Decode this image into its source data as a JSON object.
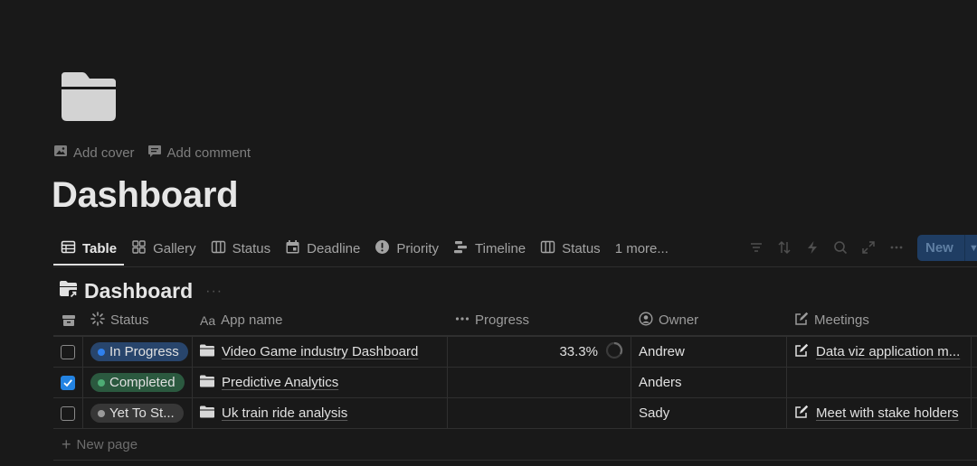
{
  "page": {
    "icon": "folder-icon",
    "add_cover": "Add cover",
    "add_comment": "Add comment",
    "title": "Dashboard"
  },
  "tabs": [
    {
      "label": "Table",
      "icon": "table-icon",
      "active": true
    },
    {
      "label": "Gallery",
      "icon": "gallery-icon"
    },
    {
      "label": "Status",
      "icon": "board-icon"
    },
    {
      "label": "Deadline",
      "icon": "calendar-icon"
    },
    {
      "label": "Priority",
      "icon": "alert-icon"
    },
    {
      "label": "Timeline",
      "icon": "timeline-icon"
    },
    {
      "label": "Status",
      "icon": "board-icon"
    },
    {
      "label": "1 more..."
    }
  ],
  "toolbar": {
    "icons": [
      "filter-icon",
      "sort-icon",
      "automation-icon",
      "search-icon",
      "expand-icon",
      "more-icon"
    ],
    "new_label": "New"
  },
  "database": {
    "title": "Dashboard",
    "more": "···"
  },
  "columns": [
    {
      "label": "Status",
      "icon": "status-icon"
    },
    {
      "label": "App name",
      "icon": "title-icon"
    },
    {
      "label": "Progress",
      "icon": "rollup-icon"
    },
    {
      "label": "Owner",
      "icon": "person-icon"
    },
    {
      "label": "Meetings",
      "icon": "relation-icon"
    }
  ],
  "rows": [
    {
      "checked": false,
      "status": "In Progress",
      "status_bg": "#28456c",
      "status_dot": "#2f80ed",
      "app_name": "Video Game industry Dashboard",
      "progress": "33.3%",
      "owner": "Andrew",
      "meeting": "Data viz application m..."
    },
    {
      "checked": true,
      "status": "Completed",
      "status_bg": "#2b593f",
      "status_dot": "#4dab74",
      "app_name": "Predictive Analytics",
      "progress": "",
      "owner": "Anders",
      "meeting": ""
    },
    {
      "checked": false,
      "status": "Yet To St...",
      "status_bg": "#373737",
      "status_dot": "#9b9b9b",
      "app_name": "Uk train ride analysis",
      "progress": "",
      "owner": "Sady",
      "meeting": "Meet with stake holders"
    }
  ],
  "new_page": "New page"
}
